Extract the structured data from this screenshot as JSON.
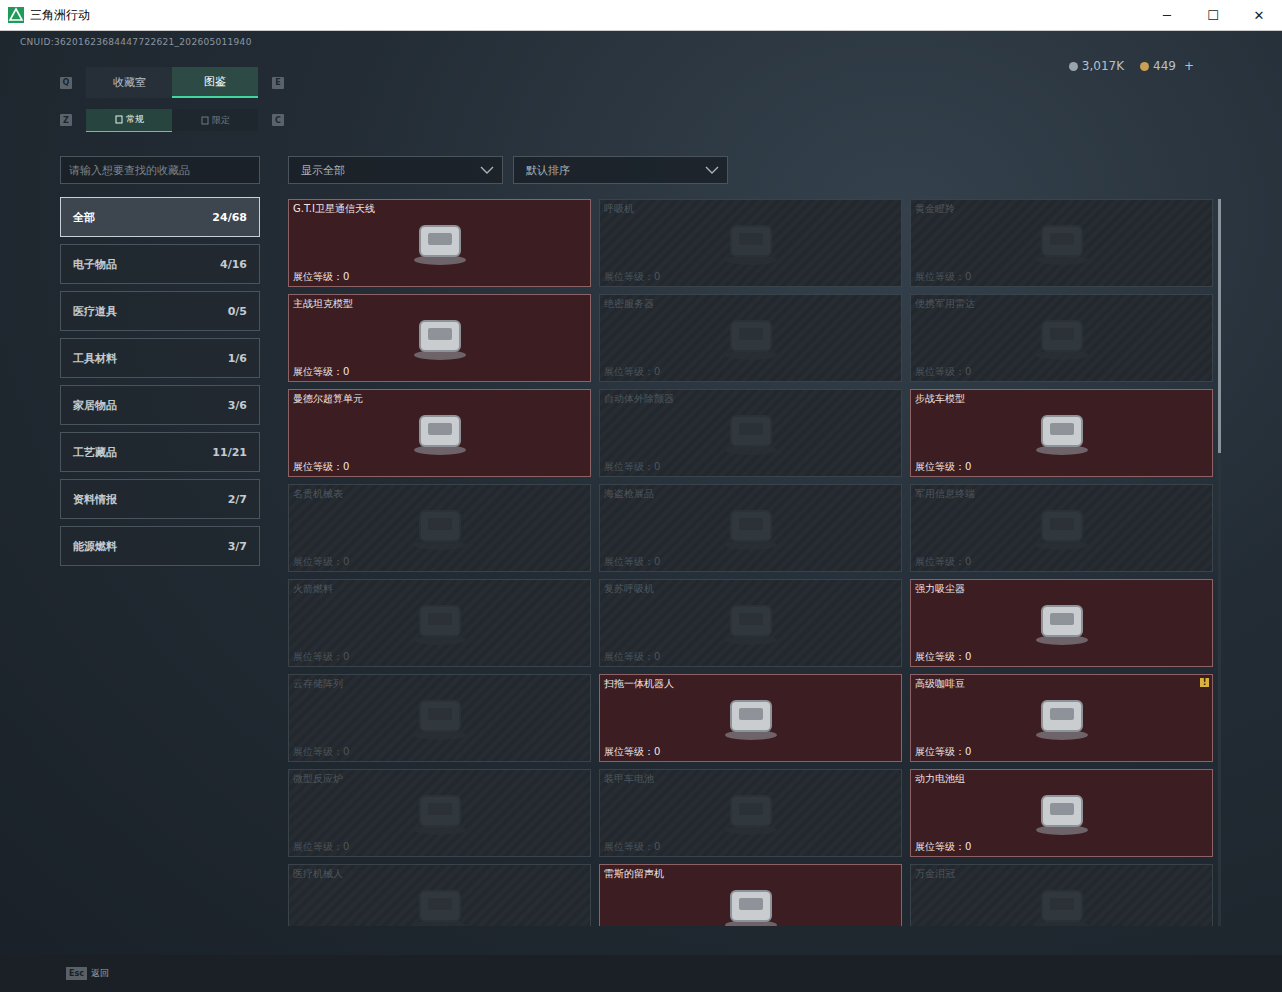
{
  "window": {
    "title": "三角洲行动",
    "controls": [
      "─",
      "☐",
      "✕"
    ]
  },
  "uid": "CNUID:36201623684447722621_202605011940",
  "currency": [
    {
      "amount": "3,017K",
      "color": "#9aa4ad"
    },
    {
      "amount": "449",
      "suffix": "+",
      "color": "#c9a055"
    }
  ],
  "tab_keys": [
    "Q",
    "E"
  ],
  "tabs": [
    {
      "label": "收藏室",
      "selected": false
    },
    {
      "label": "图鉴",
      "selected": true
    }
  ],
  "subtab_keys": [
    "Z",
    "C"
  ],
  "subtabs": [
    {
      "label": "常规",
      "selected": true
    },
    {
      "label": "限定",
      "selected": false
    }
  ],
  "search": {
    "placeholder": "请输入想要查找的收藏品"
  },
  "filters": [
    "显示全部",
    "默认排序"
  ],
  "sidebar": {
    "items": [
      {
        "label": "全部",
        "count": "24/68",
        "selected": true
      },
      {
        "label": "电子物品",
        "count": "4/16",
        "selected": false
      },
      {
        "label": "医疗道具",
        "count": "0/5",
        "selected": false
      },
      {
        "label": "工具材料",
        "count": "1/6",
        "selected": false
      },
      {
        "label": "家居物品",
        "count": "3/6",
        "selected": false
      },
      {
        "label": "工艺藏品",
        "count": "11/21",
        "selected": false
      },
      {
        "label": "资料情报",
        "count": "2/7",
        "selected": false
      },
      {
        "label": "能源燃料",
        "count": "3/7",
        "selected": false
      }
    ]
  },
  "grid": {
    "items": [
      {
        "name": "G.T.I卫星通信天线",
        "level": "展位等级：0",
        "collected": true
      },
      {
        "name": "呼吸机",
        "level": "展位等级：0",
        "collected": false
      },
      {
        "name": "黄金瞪羚",
        "level": "展位等级：0",
        "collected": false
      },
      {
        "name": "主战坦克模型",
        "level": "展位等级：0",
        "collected": true
      },
      {
        "name": "绝密服务器",
        "level": "展位等级：0",
        "collected": false
      },
      {
        "name": "便携军用雷达",
        "level": "展位等级：0",
        "collected": false
      },
      {
        "name": "曼德尔超算单元",
        "level": "展位等级：0",
        "collected": true
      },
      {
        "name": "自动体外除颤器",
        "level": "展位等级：0",
        "collected": false
      },
      {
        "name": "步战车模型",
        "level": "展位等级：0",
        "collected": true
      },
      {
        "name": "名贵机械表",
        "level": "展位等级：0",
        "collected": false
      },
      {
        "name": "海盗枪展品",
        "level": "展位等级：0",
        "collected": false
      },
      {
        "name": "军用信息终端",
        "level": "展位等级：0",
        "collected": false
      },
      {
        "name": "火箭燃料",
        "level": "展位等级：0",
        "collected": false
      },
      {
        "name": "复苏呼吸机",
        "level": "展位等级：0",
        "collected": false
      },
      {
        "name": "强力吸尘器",
        "level": "展位等级：0",
        "collected": true
      },
      {
        "name": "云存储阵列",
        "level": "展位等级：0",
        "collected": false
      },
      {
        "name": "扫拖一体机器人",
        "level": "展位等级：0",
        "collected": true
      },
      {
        "name": "高级咖啡豆",
        "level": "展位等级：0",
        "collected": true,
        "badge": "!"
      },
      {
        "name": "微型反应炉",
        "level": "展位等级：0",
        "collected": false
      },
      {
        "name": "装甲车电池",
        "level": "展位等级：0",
        "collected": false
      },
      {
        "name": "动力电池组",
        "level": "展位等级：0",
        "collected": true
      },
      {
        "name": "医疗机械人",
        "collected": false
      },
      {
        "name": "雷斯的留声机",
        "collected": true
      },
      {
        "name": "万金泪冠",
        "collected": false
      }
    ]
  },
  "scrollbar": {
    "level": 0.35
  },
  "footer": {
    "key": "Esc",
    "label": "返回"
  }
}
